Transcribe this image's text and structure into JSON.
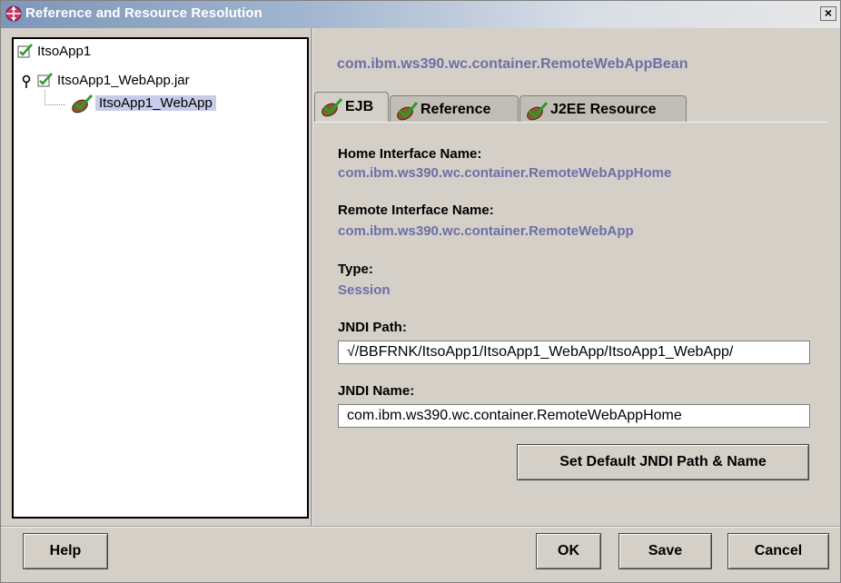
{
  "window": {
    "title": "Reference and Resource Resolution",
    "close_icon": "close-icon"
  },
  "tree": {
    "nodes": [
      {
        "label": "ItsoApp1",
        "icon": "checked-box-icon",
        "checked": true,
        "selected": false
      },
      {
        "label": "ItsoApp1_WebApp.jar",
        "icon": "checked-box-icon",
        "checked": true,
        "expander_icon": "expanded-node-icon",
        "selected": false
      },
      {
        "label": "ItsoApp1_WebApp",
        "icon": "bean-check-icon",
        "checked": true,
        "selected": true
      }
    ]
  },
  "panel": {
    "title": "com.ibm.ws390.wc.container.RemoteWebAppBean",
    "tabs": [
      {
        "label": "EJB",
        "active": true,
        "icon": "bean-check-icon"
      },
      {
        "label": "Reference",
        "active": false,
        "icon": "bean-check-icon"
      },
      {
        "label": "J2EE Resource",
        "active": false,
        "icon": "bean-check-icon"
      }
    ],
    "fields": {
      "home_label": "Home Interface Name:",
      "home_value": "com.ibm.ws390.wc.container.RemoteWebAppHome",
      "remote_label": "Remote Interface Name:",
      "remote_value": "com.ibm.ws390.wc.container.RemoteWebApp",
      "type_label": "Type:",
      "type_value": "Session",
      "jndi_path_label": "JNDI Path:",
      "jndi_path_value": "√/BBFRNK/ItsoApp1/ItsoApp1_WebApp/ItsoApp1_WebApp/",
      "jndi_name_label": "JNDI Name:",
      "jndi_name_value": "com.ibm.ws390.wc.container.RemoteWebAppHome"
    },
    "set_default_button": "Set Default JNDI Path & Name"
  },
  "footer": {
    "help": "Help",
    "ok": "OK",
    "save": "Save",
    "cancel": "Cancel"
  },
  "colors": {
    "window_bg": "#d4d0c8",
    "accent_text": "#6e6ea8",
    "selection": "#c8cce8",
    "check_green": "#2e9a2e",
    "bean_brown": "#8b5a2b"
  }
}
